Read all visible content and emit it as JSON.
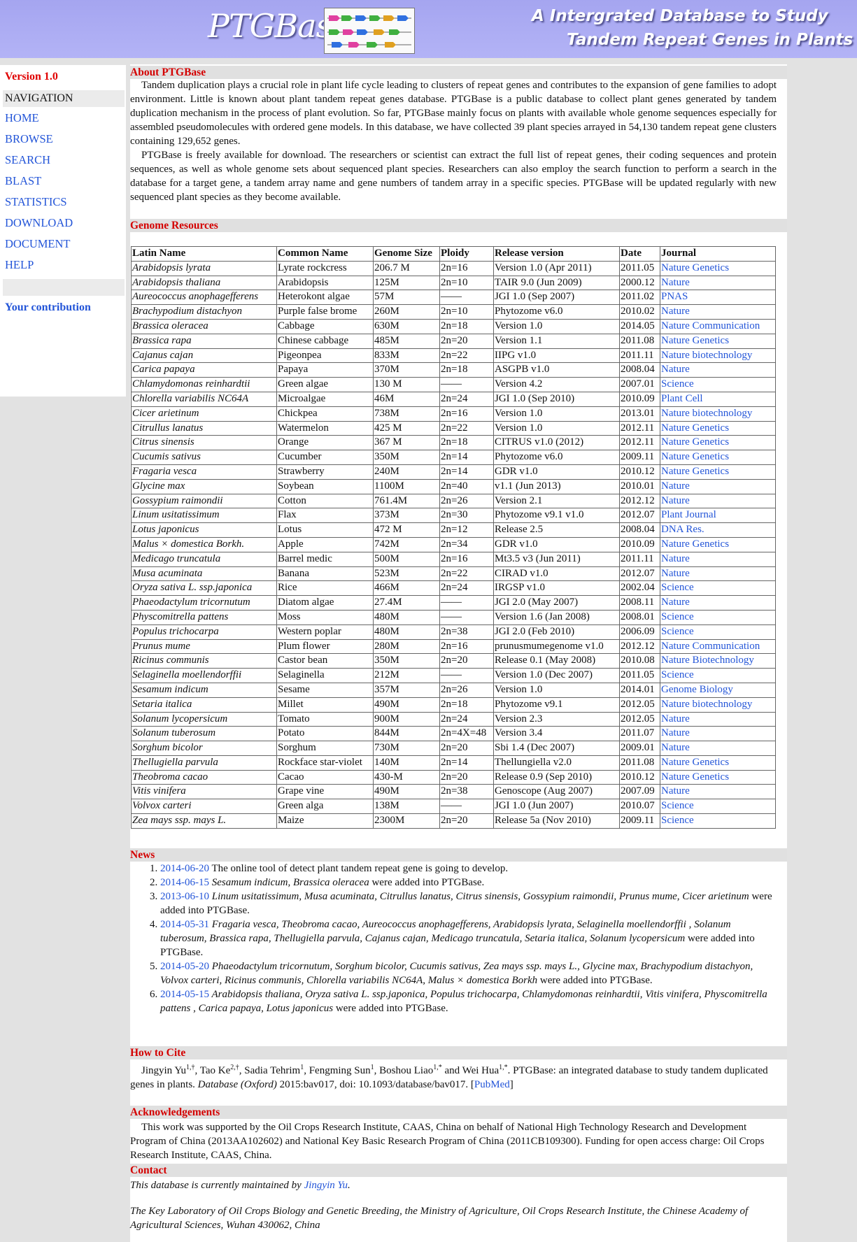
{
  "header": {
    "logo_text": "PTGBase",
    "tagline_line1": "A Intergrated Database to Study",
    "tagline_line2": "Tandem Repeat Genes in Plants"
  },
  "sidebar": {
    "version": "Version 1.0",
    "nav_heading": "NAVIGATION",
    "items": [
      "HOME",
      "BROWSE",
      "SEARCH",
      "BLAST",
      "STATISTICS",
      "DOWNLOAD",
      "DOCUMENT",
      "HELP"
    ],
    "contribution": "Your contribution"
  },
  "about": {
    "heading": "About PTGBase",
    "p1": "Tandem duplication plays a crucial role in plant life cycle leading to clusters of repeat genes and contributes to the expansion of gene families to adopt environment. Little is known about plant tandem repeat genes database. PTGBase is a public database to collect plant genes generated by tandem duplication mechanism in the process of plant evolution. So far, PTGBase mainly focus on plants with available whole genome sequences especially for assembled pseudomolecules with ordered gene models. In this database, we have collected 39 plant species arrayed in 54,130 tandem repeat gene clusters containing 129,652 genes.",
    "p2": "PTGBase is freely available for download. The researchers or scientist can extract the full list of repeat genes, their coding sequences and protein sequences, as well as whole genome sets about sequenced plant species. Researchers can also employ the search function to perform a search in the database for a target gene, a tandem array name and gene numbers of tandem array in a specific species. PTGBase will be updated regularly with new sequenced plant species as they become available."
  },
  "genome": {
    "heading": "Genome Resources",
    "columns": [
      "Latin Name",
      "Common Name",
      "Genome Size",
      "Ploidy",
      "Release version",
      "Date",
      "Journal"
    ],
    "rows": [
      [
        "Arabidopsis lyrata",
        "Lyrate rockcress",
        "206.7 M",
        "2n=16",
        "Version 1.0 (Apr 2011)",
        "2011.05",
        "Nature Genetics"
      ],
      [
        "Arabidopsis thaliana",
        "Arabidopsis",
        "125M",
        "2n=10",
        "TAIR 9.0 (Jun 2009)",
        "2000.12",
        "Nature"
      ],
      [
        "Aureococcus anophagefferens",
        "Heterokont algae",
        "57M",
        "——",
        "JGI 1.0 (Sep 2007)",
        "2011.02",
        "PNAS"
      ],
      [
        "Brachypodium distachyon",
        "Purple false brome",
        "260M",
        "2n=10",
        "Phytozome v6.0",
        "2010.02",
        "Nature"
      ],
      [
        "Brassica oleracea",
        "Cabbage",
        "630M",
        "2n=18",
        "Version 1.0",
        "2014.05",
        "Nature Communication"
      ],
      [
        "Brassica rapa",
        "Chinese cabbage",
        "485M",
        "2n=20",
        "Version 1.1",
        "2011.08",
        "Nature Genetics"
      ],
      [
        "Cajanus cajan",
        "Pigeonpea",
        "833M",
        "2n=22",
        "IIPG v1.0",
        "2011.11",
        "Nature biotechnology"
      ],
      [
        "Carica papaya",
        "Papaya",
        "370M",
        "2n=18",
        "ASGPB v1.0",
        "2008.04",
        "Nature"
      ],
      [
        "Chlamydomonas reinhardtii",
        "Green algae",
        "130 M",
        "——",
        "Version 4.2",
        "2007.01",
        "Science"
      ],
      [
        "Chlorella variabilis NC64A",
        "Microalgae",
        "46M",
        "2n=24",
        "JGI 1.0 (Sep 2010)",
        "2010.09",
        "Plant Cell"
      ],
      [
        "Cicer arietinum",
        "Chickpea",
        "738M",
        "2n=16",
        "Version 1.0",
        "2013.01",
        "Nature biotechnology"
      ],
      [
        "Citrullus lanatus",
        "Watermelon",
        "425 M",
        "2n=22",
        "Version 1.0",
        "2012.11",
        "Nature Genetics"
      ],
      [
        "Citrus sinensis",
        "Orange",
        "367 M",
        "2n=18",
        "CITRUS v1.0 (2012)",
        "2012.11",
        "Nature Genetics"
      ],
      [
        "Cucumis sativus",
        "Cucumber",
        "350M",
        "2n=14",
        "Phytozome v6.0",
        "2009.11",
        "Nature Genetics"
      ],
      [
        "Fragaria vesca",
        "Strawberry",
        "240M",
        "2n=14",
        "GDR v1.0",
        "2010.12",
        "Nature Genetics"
      ],
      [
        "Glycine max",
        "Soybean",
        "1100M",
        "2n=40",
        "v1.1 (Jun 2013)",
        "2010.01",
        "Nature"
      ],
      [
        "Gossypium raimondii",
        "Cotton",
        "761.4M",
        "2n=26",
        "Version 2.1",
        "2012.12",
        "Nature"
      ],
      [
        "Linum usitatissimum",
        "Flax",
        "373M",
        "2n=30",
        "Phytozome v9.1 v1.0",
        "2012.07",
        "Plant Journal"
      ],
      [
        "Lotus japonicus",
        "Lotus",
        "472 M",
        "2n=12",
        "Release 2.5",
        "2008.04",
        "DNA Res."
      ],
      [
        "Malus × domestica Borkh.",
        "Apple",
        "742M",
        "2n=34",
        "GDR v1.0",
        "2010.09",
        "Nature Genetics"
      ],
      [
        "Medicago truncatula",
        "Barrel medic",
        "500M",
        "2n=16",
        "Mt3.5 v3 (Jun 2011)",
        "2011.11",
        "Nature"
      ],
      [
        "Musa acuminata",
        "Banana",
        "523M",
        "2n=22",
        "CIRAD v1.0",
        "2012.07",
        "Nature"
      ],
      [
        "Oryza sativa L. ssp.japonica",
        "Rice",
        "466M",
        "2n=24",
        "IRGSP v1.0",
        "2002.04",
        "Science"
      ],
      [
        "Phaeodactylum tricornutum",
        "Diatom algae",
        "27.4M",
        "——",
        "JGI 2.0 (May 2007)",
        "2008.11",
        "Nature"
      ],
      [
        "Physcomitrella pattens",
        "Moss",
        "480M",
        "——",
        "Version 1.6 (Jan 2008)",
        "2008.01",
        "Science"
      ],
      [
        "Populus trichocarpa",
        "Western poplar",
        "480M",
        "2n=38",
        "JGI 2.0 (Feb 2010)",
        "2006.09",
        "Science"
      ],
      [
        "Prunus mume",
        "Plum flower",
        "280M",
        "2n=16",
        "prunusmumegenome v1.0",
        "2012.12",
        "Nature Communication"
      ],
      [
        "Ricinus communis",
        "Castor bean",
        "350M",
        "2n=20",
        "Release 0.1 (May 2008)",
        "2010.08",
        "Nature Biotechnology"
      ],
      [
        "Selaginella moellendorffii",
        "Selaginella",
        "212M",
        "——",
        "Version 1.0 (Dec 2007)",
        "2011.05",
        "Science"
      ],
      [
        "Sesamum indicum",
        "Sesame",
        "357M",
        "2n=26",
        "Version 1.0",
        "2014.01",
        "Genome Biology"
      ],
      [
        "Setaria italica",
        "Millet",
        "490M",
        "2n=18",
        "Phytozome v9.1",
        "2012.05",
        "Nature biotechnology"
      ],
      [
        "Solanum lycopersicum",
        "Tomato",
        "900M",
        "2n=24",
        "Version 2.3",
        "2012.05",
        "Nature"
      ],
      [
        "Solanum tuberosum",
        "Potato",
        "844M",
        "2n=4X=48",
        "Version 3.4",
        "2011.07",
        "Nature"
      ],
      [
        "Sorghum bicolor",
        "Sorghum",
        "730M",
        "2n=20",
        "Sbi 1.4 (Dec 2007)",
        "2009.01",
        "Nature"
      ],
      [
        "Thellugiella parvula",
        "Rockface star-violet",
        "140M",
        "2n=14",
        "Thellungiella v2.0",
        "2011.08",
        "Nature Genetics"
      ],
      [
        "Theobroma cacao",
        "Cacao",
        "430-M",
        "2n=20",
        "Release 0.9 (Sep 2010)",
        "2010.12",
        "Nature Genetics"
      ],
      [
        "Vitis vinifera",
        "Grape vine",
        "490M",
        "2n=38",
        "Genoscope (Aug 2007)",
        "2007.09",
        "Nature"
      ],
      [
        "Volvox carteri",
        "Green alga",
        "138M",
        "——",
        "JGI 1.0 (Jun 2007)",
        "2010.07",
        "Science"
      ],
      [
        "Zea mays ssp. mays L.",
        "Maize",
        "2300M",
        "2n=20",
        "Release 5a (Nov 2010)",
        "2009.11",
        "Science"
      ]
    ]
  },
  "news": {
    "heading": "News",
    "items": [
      {
        "date": "2014-06-20",
        "text": " The online tool of detect plant tandem repeat gene is going to develop."
      },
      {
        "date": "2014-06-15",
        "species": " Sesamum indicum, Brassica oleracea",
        "text": " were added into PTGBase."
      },
      {
        "date": "2013-06-10",
        "species": " Linum usitatissimum, Musa acuminata, Citrullus lanatus, Citrus sinensis, Gossypium raimondii, Prunus mume, Cicer arietinum",
        "text": " were added into PTGBase."
      },
      {
        "date": "2014-05-31",
        "species": " Fragaria vesca, Theobroma cacao, Aureococcus anophagefferens, Arabidopsis lyrata, Selaginella moellendorffii , Solanum tuberosum, Brassica rapa, Thellugiella parvula, Cajanus cajan, Medicago truncatula, Setaria italica, Solanum lycopersicum",
        "text": " were added into PTGBase."
      },
      {
        "date": "2014-05-20",
        "species": " Phaeodactylum tricornutum, Sorghum bicolor, Cucumis sativus, Zea mays ssp. mays L., Glycine max, Brachypodium distachyon, Volvox carteri, Ricinus communis, Chlorella variabilis NC64A, Malus × domestica Borkh",
        "text": " were added into PTGBase."
      },
      {
        "date": "2014-05-15",
        "species": " Arabidopsis thaliana, Oryza sativa L. ssp.japonica, Populus trichocarpa, Chlamydomonas reinhardtii, Vitis vinifera, Physcomitrella pattens ,  Carica papaya, Lotus japonicus",
        "text": " were added into PTGBase."
      }
    ]
  },
  "cite": {
    "heading": "How to Cite",
    "authors": "Jingyin Yu1,†, Tao Ke2,†, Sadia Tehrim1, Fengming Sun1, Boshou Liao1,* and Wei Hua1,*.",
    "text_a": " PTGBase: an integrated database to study tandem duplicated genes in plants. ",
    "journal": "Database (Oxford)",
    "text_b": " 2015:bav017, doi: 10.1093/database/bav017. [",
    "pubmed": "PubMed",
    "text_c": "]"
  },
  "ack": {
    "heading": "Acknowledgements",
    "text": "This work was supported by the Oil Crops Research Institute, CAAS, China on behalf of National High Technology Research and Development Program of China (2013AA102602) and National Key Basic Research Program of China (2011CB109300). Funding for open access charge: Oil Crops Research Institute, CAAS, China."
  },
  "contact": {
    "heading": "Contact",
    "line1": "This database is currently maintained by ",
    "maintainer": "Jingyin Yu",
    "line1_end": ".",
    "address": "The Key Laboratory of Oil Crops Biology and Genetic Breeding, the Ministry of Agriculture, Oil Crops Research Institute, the Chinese Academy of Agricultural Sciences, Wuhan 430062, China"
  }
}
